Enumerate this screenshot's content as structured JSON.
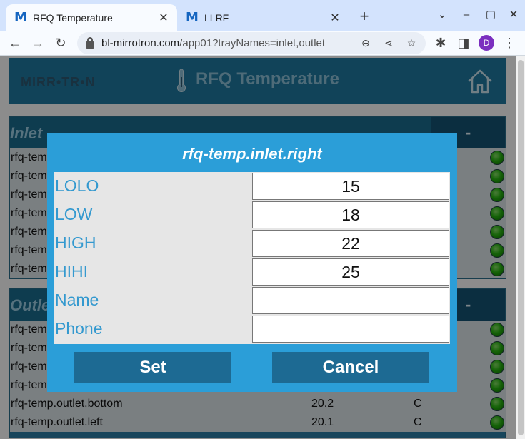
{
  "browser": {
    "tabs": [
      {
        "label": "RFQ Temperature",
        "favicon": "M"
      },
      {
        "label": "LLRF",
        "favicon": "M"
      }
    ],
    "url_host": "bl-mirrotron.com",
    "url_path": "/app01?trayNames=inlet,outlet",
    "profile_initial": "D"
  },
  "header": {
    "logo": "MIRR•TR•N",
    "title": "RFQ Temperature"
  },
  "inlet": {
    "title": "Inlet",
    "minus": "-",
    "rows": [
      {
        "name": "rfq-tem"
      },
      {
        "name": "rfq-tem"
      },
      {
        "name": "rfq-tem"
      },
      {
        "name": "rfq-tem"
      },
      {
        "name": "rfq-tem"
      },
      {
        "name": "rfq-tem"
      },
      {
        "name": "rfq-tem"
      }
    ]
  },
  "outlet": {
    "title": "Outle",
    "minus": "-",
    "rows": [
      {
        "name": "rfq-tem",
        "value": "",
        "unit": ""
      },
      {
        "name": "rfq-tem",
        "value": "",
        "unit": ""
      },
      {
        "name": "rfq-tem",
        "value": "",
        "unit": ""
      },
      {
        "name": "rfq-tem",
        "value": "",
        "unit": ""
      },
      {
        "name": "rfq-temp.outlet.bottom",
        "value": "20.2",
        "unit": "C"
      },
      {
        "name": "rfq-temp.outlet.left",
        "value": "20.1",
        "unit": "C"
      }
    ]
  },
  "modal": {
    "title": "rfq-temp.inlet.right",
    "fields": [
      {
        "label": "LOLO",
        "value": "15"
      },
      {
        "label": "LOW",
        "value": "18"
      },
      {
        "label": "HIGH",
        "value": "22"
      },
      {
        "label": "HIHI",
        "value": "25"
      },
      {
        "label": "Name",
        "value": ""
      },
      {
        "label": "Phone",
        "value": ""
      }
    ],
    "set_label": "Set",
    "cancel_label": "Cancel"
  },
  "colors": {
    "accent": "#1f7ba3",
    "modal": "#2b9ed8",
    "status_ok": "#28b511"
  }
}
